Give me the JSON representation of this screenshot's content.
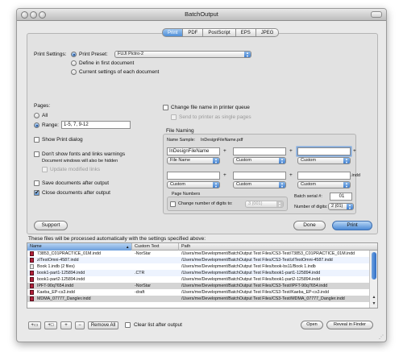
{
  "window": {
    "title": "BatchOutput"
  },
  "tabs": [
    "Print",
    "PDF",
    "PostScript",
    "EPS",
    "JPEG"
  ],
  "print_settings": {
    "label": "Print Settings:",
    "option_preset": "Print Preset:",
    "preset_value": "FUJI Pictro-2",
    "option_define": "Define in first document",
    "option_current": "Current settings of each document"
  },
  "pages": {
    "label": "Pages:",
    "option_all": "All",
    "option_range": "Range:",
    "range_value": "1-5, 7, 9-12"
  },
  "options": {
    "show_print_dialog": "Show Print dialog",
    "dont_show_fonts": "Don't show fonts and links warnings",
    "hidden_note": "Document windows will also be hidden",
    "update_links": "Update modified links",
    "save_docs": "Save documents after output",
    "close_docs": "Close documents after output"
  },
  "queue": {
    "change_name": "Change file name in printer queue",
    "send_single": "Send to printer as single pages"
  },
  "naming": {
    "title": "File Naming",
    "sample_label": "Name Sample:",
    "sample_value": "InDesignFileName.pdf",
    "row1_field1": "InDesignFileName",
    "row1_popup1": "File Name",
    "row1_popup2": "Custom",
    "row1_popup3": "Custom",
    "row2_popup1": "Custom",
    "row2_popup2": "Custom",
    "row2_popup3": "Custom",
    "ext": ".indd",
    "page_numbers_title": "Page Numbers",
    "change_digits": "Change number of digits to:",
    "digits_popup": "3 (001)",
    "batch_serial_label": "Batch serial #:",
    "batch_serial_value": "01",
    "num_digits_label": "Number of digits:",
    "num_digits_value": "2 (01)"
  },
  "buttons": {
    "support": "Support",
    "done": "Done",
    "print": "Print"
  },
  "list_caption": "These files will be processed automatically with the settings specified above:",
  "table": {
    "columns": [
      "Name",
      "Custom Text",
      "Path"
    ],
    "rows": [
      {
        "name": "73853_C01PRACTICE_01M.indd",
        "custom": "-NorStar",
        "path": "/Users/me/Development/BatchOutput Test Files/CS3-Test/73853_C01PRACTICE_01M.indd"
      },
      {
        "name": "zITestOmni-4587.indd",
        "custom": "",
        "path": "/Users/me/Development/BatchOutput Test Files/CS3-Test/zITestOmni-4587.indd"
      },
      {
        "name": "Book 1.indb (2 files)",
        "custom": "",
        "path": "/Users/me/Development/BatchOutput Test Files/book-bs11/Book 1.indb"
      },
      {
        "name": "book1-part1-125894.indd",
        "custom": ".CTR",
        "path": "/Users/me/Development/BatchOutput Test Files/book1-part1-125894.indd"
      },
      {
        "name": "book1-part2-125894.indd",
        "custom": "",
        "path": "/Users/me/Development/BatchOutput Test Files/book1-part2-125894.indd"
      },
      {
        "name": "IPFT-90q7654.indd",
        "custom": "-NorStar",
        "path": "/Users/me/Development/BatchOutput Test Files/CS3-Test/IPFT-90q7654.indd"
      },
      {
        "name": "Kaeba_EP-cs3.indd",
        "custom": "-draft",
        "path": "/Users/me/Development/BatchOutput Test Files/CS3-Test/Kaeba_EP-cs3.indd"
      },
      {
        "name": "MDMA_07777_Dangler.indd",
        "custom": "",
        "path": "/Users/me/Development/BatchOutput Test Files/CS3-Test/MDMA_07777_Dangler.indd"
      }
    ]
  },
  "bottom": {
    "add_folder": "+▭",
    "add_file": "+□",
    "add_item": "+",
    "remove": "−",
    "remove_all": "Remove All",
    "clear_list": "Clear list after output",
    "open": "Open",
    "reveal": "Reveal in Finder"
  }
}
